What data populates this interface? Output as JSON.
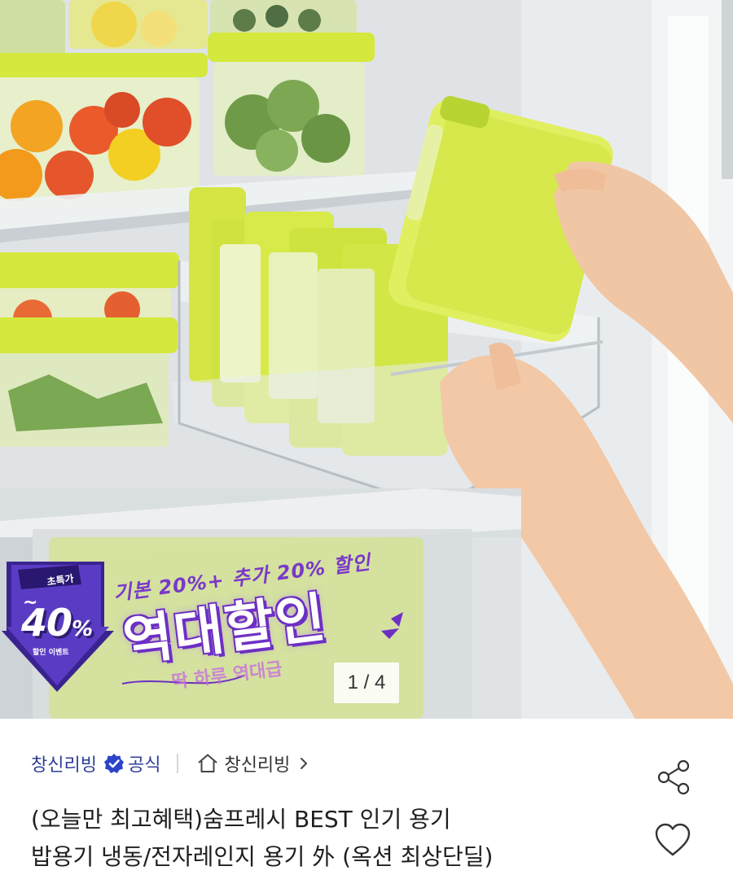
{
  "product_image": {
    "badge_top": "초특가",
    "badge_tilde": "~",
    "badge_value": "40",
    "badge_percent": "%",
    "badge_sub": "할인 이벤트",
    "promo_line1": "기본 20%+ 추가 20% 할인",
    "promo_line2": "역대할인",
    "promo_line3": "딱 하루 역대급",
    "page_counter": "1 / 4",
    "accent_purple": "#6d2fc4",
    "container_lid_color": "#d8ec4a"
  },
  "store": {
    "name": "창신리빙",
    "verified_icon": "verified-check-icon",
    "official_label": "공식",
    "home_icon": "home-icon",
    "link_label": "창신리빙",
    "chevron_icon": "chevron-right-icon",
    "name_color": "#2e3e96"
  },
  "product": {
    "title_line1": "(오늘만 최고혜택)숨프레시 BEST 인기 용기",
    "title_line2": "밥용기 냉동/전자레인지 용기 外 (옥션 최상단딜)"
  },
  "actions": {
    "share_icon": "share-icon",
    "like_icon": "heart-icon"
  }
}
